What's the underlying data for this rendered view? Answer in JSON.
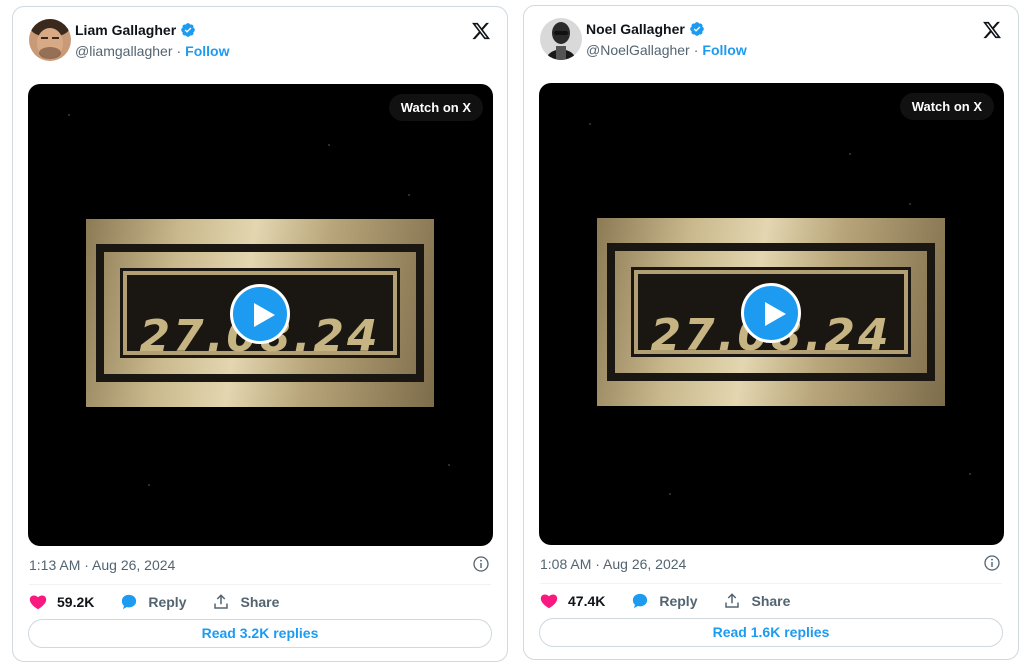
{
  "tweets": [
    {
      "name": "Liam Gallagher",
      "handle": "@liamgallagher",
      "separator": "·",
      "follow_label": "Follow",
      "watch_label": "Watch on X",
      "video_text": "27.08.24",
      "timestamp": "1:13 AM · Aug 26, 2024",
      "likes": "59.2K",
      "reply_label": "Reply",
      "share_label": "Share",
      "read_replies_label": "Read 3.2K replies"
    },
    {
      "name": "Noel Gallagher",
      "handle": "@NoelGallagher",
      "separator": "·",
      "follow_label": "Follow",
      "watch_label": "Watch on X",
      "video_text": "27.08.24",
      "timestamp": "1:08 AM · Aug 26, 2024",
      "likes": "47.4K",
      "reply_label": "Reply",
      "share_label": "Share",
      "read_replies_label": "Read 1.6K replies"
    }
  ],
  "colors": {
    "accent": "#1d9bf0",
    "like": "#f91880",
    "text_secondary": "#536471"
  },
  "icons": [
    "verified-badge-icon",
    "x-logo-icon",
    "play-icon",
    "info-icon",
    "heart-icon",
    "reply-bubble-icon",
    "share-icon"
  ]
}
